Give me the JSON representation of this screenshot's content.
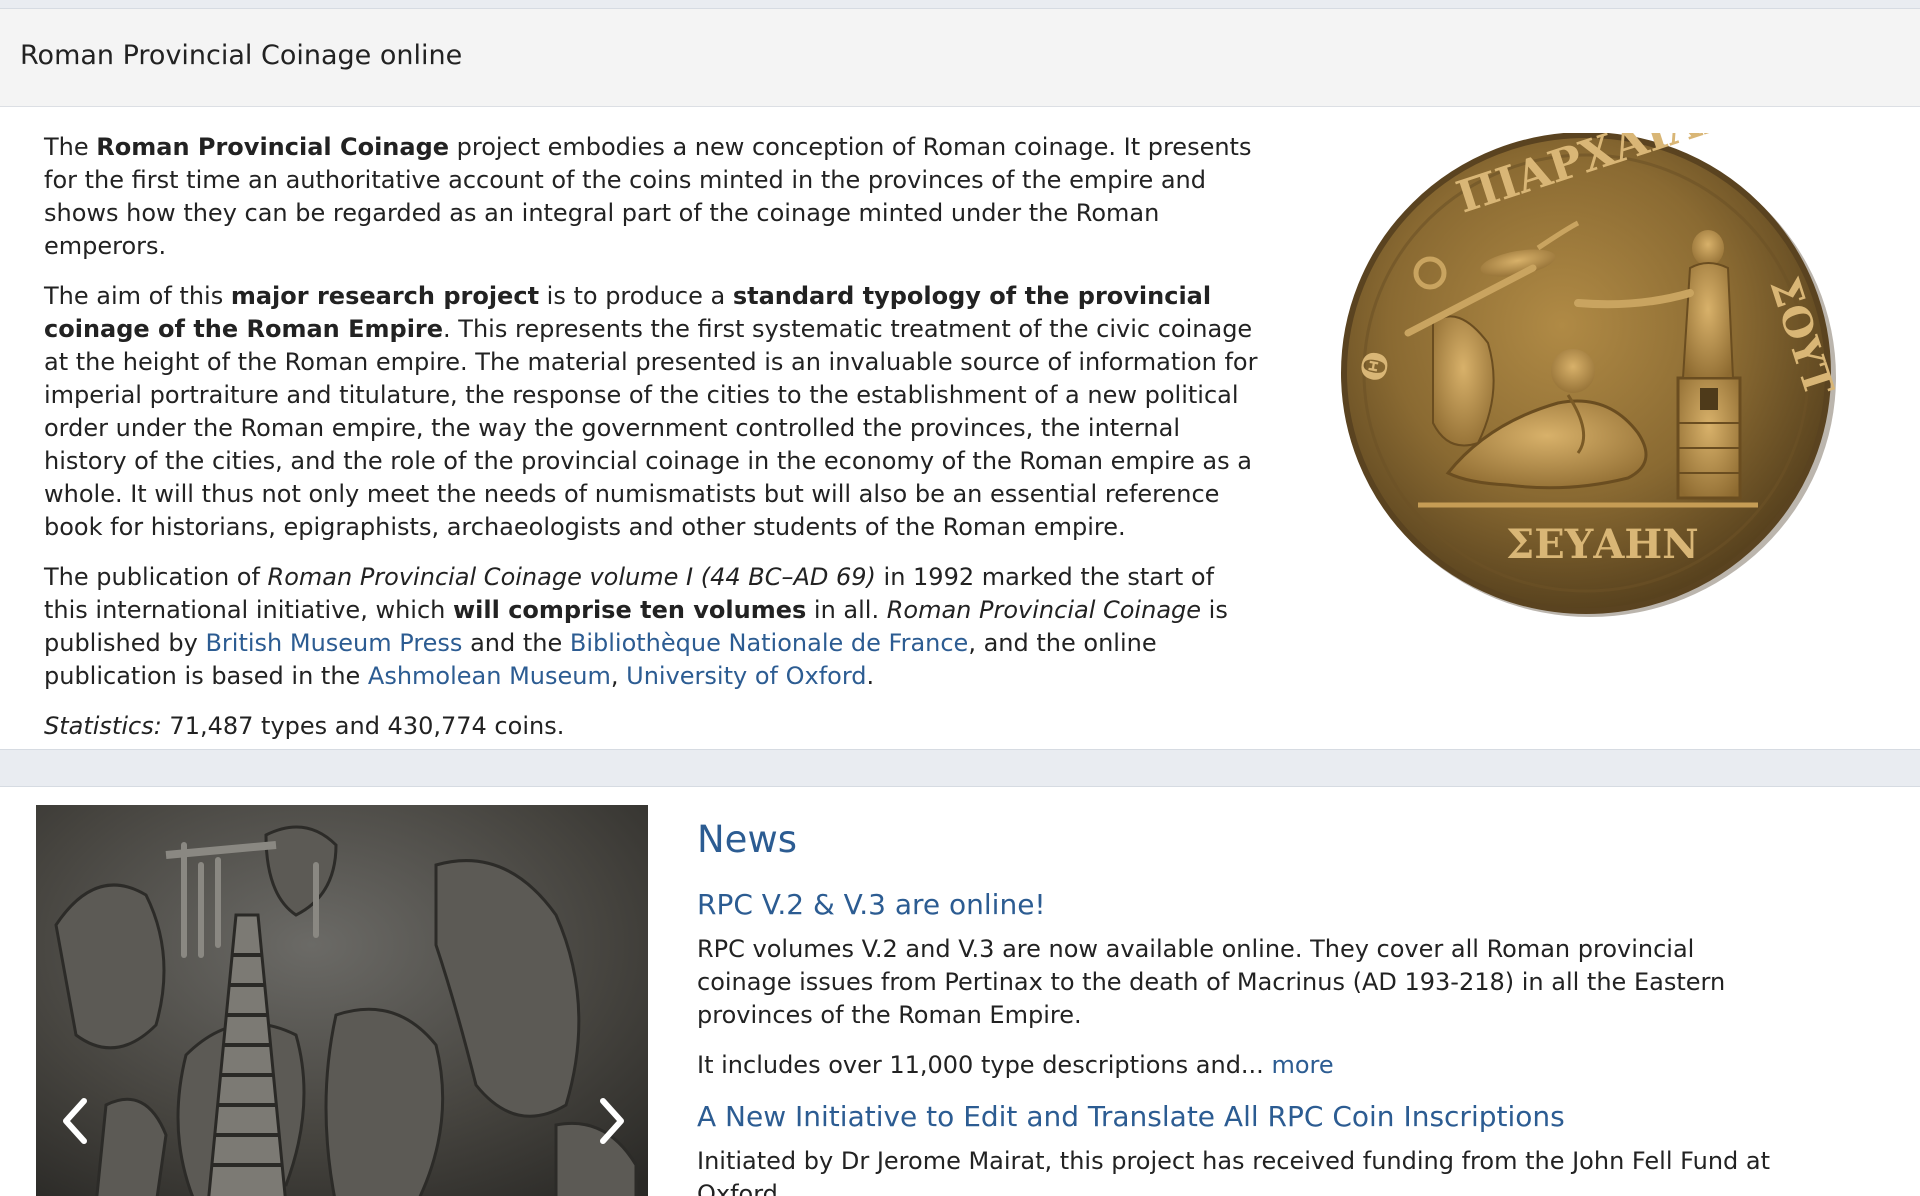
{
  "card": {
    "title": "Roman Provincial Coinage online"
  },
  "intro": {
    "p1": {
      "pre": "The ",
      "bold": "Roman Provincial Coinage",
      "post": " project embodies a new conception of Roman coinage. It presents for the first time an authoritative account of the coins minted in the provinces of the empire and shows how they can be regarded as an integral part of the coinage minted under the Roman emperors."
    },
    "p2": {
      "t1": "The aim of this ",
      "b1": "major research project",
      "t2": " is to produce a ",
      "b2": "standard typology of the provincial coinage of the Roman Empire",
      "t3": ". This represents the first systematic treatment of the civic coinage at the height of the Roman empire. The material presented is an invaluable source of information for imperial portraiture and titulature, the response of the cities to the establishment of a new political order under the Roman empire, the way the government controlled the provinces, the internal history of the cities, and the role of the provincial coinage in the economy of the Roman empire as a whole. It will thus not only meet the needs of numismatists but will also be an essential reference book for historians, epigraphists, archaeologists and other students of the Roman empire."
    },
    "p3": {
      "t1": "The publication of ",
      "i1": "Roman Provincial Coinage volume I (44 BC–AD 69)",
      "t2": " in 1992 marked the start of this international initiative, which ",
      "b1": "will comprise ten volumes",
      "t3": " in all. ",
      "i2": "Roman Provincial Coinage",
      "t4": " is published by ",
      "link1": "British Museum Press",
      "t5": " and the ",
      "link2": "Bibliothèque Nationale de France",
      "t6": ", and the online publication is based in the ",
      "link3": "Ashmolean Museum",
      "t7": ", ",
      "link4": "University of Oxford",
      "t8": "."
    },
    "stats": {
      "label": "Statistics:",
      "text": " 71,487 types and 430,774 coins."
    }
  },
  "coin": {
    "inscription_top": "ΠΙΑΡΧΑΙΛΖΩ",
    "inscription_right": "ΣΟΥΤ",
    "inscription_bottom": "ΣΕΥΑΗΝ",
    "inscription_left": "Θ"
  },
  "news": {
    "heading": "News",
    "items": [
      {
        "title": "RPC V.2 & V.3 are online!",
        "p1": "RPC volumes V.2 and V.3 are now available online. They cover all Roman provincial coinage issues from Pertinax to the death of Macrinus (AD 193-218) in all the Eastern provinces of the Roman Empire.",
        "p2": "It includes over 11,000 type descriptions and... ",
        "more": "more"
      },
      {
        "title": "A New Initiative to Edit and Translate All RPC Coin Inscriptions",
        "p1": "Initiated by Dr Jerome Mairat, this project has received funding from the John Fell Fund at Oxford"
      }
    ]
  },
  "carousel": {
    "prev_icon": "chevron-left-icon",
    "next_icon": "chevron-right-icon"
  }
}
